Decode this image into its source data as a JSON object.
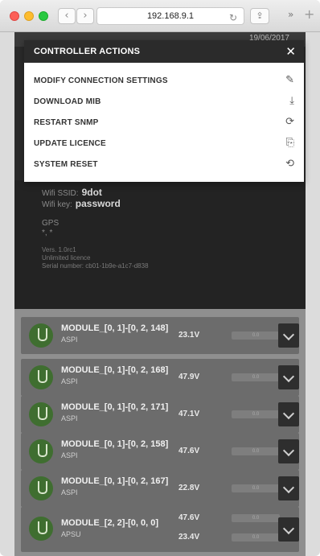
{
  "browser": {
    "url": "192.168.9.1",
    "back_glyph": "‹",
    "forward_glyph": "›",
    "reload_glyph": "↻",
    "share_glyph": "⇪",
    "more_glyph": "»",
    "newtab_glyph": "+"
  },
  "app": {
    "date": "19/06/2017",
    "wifi_ssid_label": "Wifi SSID:",
    "wifi_ssid": "9dot",
    "wifi_key_label": "Wifi key:",
    "wifi_key": "password",
    "gps_label": "GPS",
    "gps_value": "*, *",
    "version": "Vers. 1.0rc1",
    "licence": "Unlimited licence",
    "serial": "Serial number: cb01-1b9e-a1c7-d838"
  },
  "modal": {
    "title": "CONTROLLER ACTIONS",
    "close_glyph": "✕",
    "actions": [
      {
        "label": "MODIFY CONNECTION SETTINGS",
        "icon": "edit-icon",
        "glyph": "✎"
      },
      {
        "label": "DOWNLOAD MIB",
        "icon": "download-icon",
        "glyph": "⤓"
      },
      {
        "label": "RESTART SNMP",
        "icon": "refresh-icon",
        "glyph": "⟳"
      },
      {
        "label": "UPDATE LICENCE",
        "icon": "licence-icon",
        "glyph": "⎘"
      },
      {
        "label": "SYSTEM RESET",
        "icon": "reset-icon",
        "glyph": "⟲"
      }
    ]
  },
  "modules": [
    {
      "name": "MODULE_[0, 1]-[0, 2, 148]",
      "type": "ASPI",
      "voltage": "23.1V",
      "bar": "0.0"
    },
    {
      "name": "MODULE_[0, 1]-[0, 2, 168]",
      "type": "ASPI",
      "voltage": "47.9V",
      "bar": "0.0"
    },
    {
      "name": "MODULE_[0, 1]-[0, 2, 171]",
      "type": "ASPI",
      "voltage": "47.1V",
      "bar": "0.0"
    },
    {
      "name": "MODULE_[0, 1]-[0, 2, 158]",
      "type": "ASPI",
      "voltage": "47.6V",
      "bar": "0.0"
    },
    {
      "name": "MODULE_[0, 1]-[0, 2, 167]",
      "type": "ASPI",
      "voltage": "22.8V",
      "bar": "0.0"
    },
    {
      "name": "MODULE_[2, 2]-[0, 0, 0]",
      "type": "APSU",
      "voltage": "47.6V",
      "voltage2": "23.4V",
      "bar": "0.0"
    }
  ]
}
